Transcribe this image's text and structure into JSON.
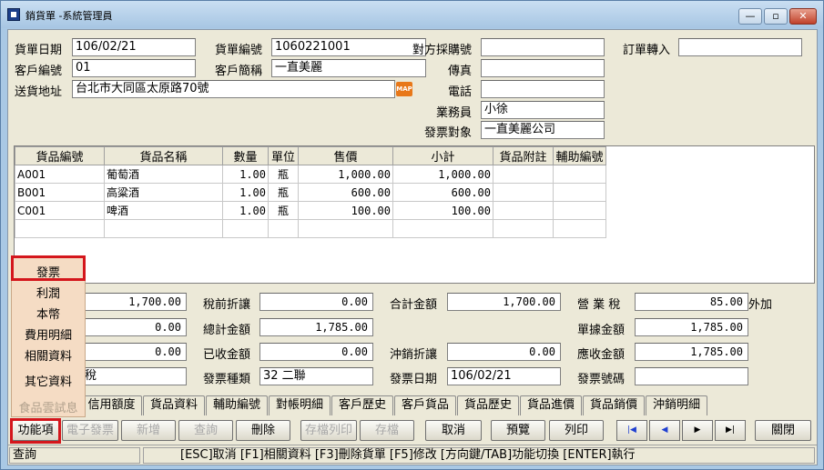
{
  "window": {
    "title": "銷貨單 -系統管理員",
    "min": "—",
    "max": "▫",
    "close": "✕"
  },
  "header": {
    "order_date_label": "貨單日期",
    "order_date": "106/02/21",
    "order_no_label": "貨單編號",
    "order_no": "1060221001",
    "po_label": "對方採購號",
    "po": "",
    "convert_label": "訂單轉入",
    "convert": "",
    "cust_no_label": "客戶編號",
    "cust_no": "01",
    "cust_name_label": "客戶簡稱",
    "cust_name": "一直美麗",
    "fax_label": "傳真",
    "fax": "",
    "address_label": "送貨地址",
    "address": "台北市大同區太原路70號",
    "map_label": "MAP",
    "phone_label": "電話",
    "phone": "",
    "sales_label": "業務員",
    "sales": "小徐",
    "invoice_to_label": "發票對象",
    "invoice_to": "一直美麗公司"
  },
  "grid": {
    "columns": [
      "貨品編號",
      "貨品名稱",
      "數量",
      "單位",
      "售價",
      "小計",
      "貨品附註",
      "輔助編號"
    ],
    "rows": [
      [
        "A001",
        "葡萄酒",
        "1.00",
        "瓶",
        "1,000.00",
        "1,000.00",
        "",
        ""
      ],
      [
        "B001",
        "高粱酒",
        "1.00",
        "瓶",
        "600.00",
        "600.00",
        "",
        ""
      ],
      [
        "C001",
        "啤酒",
        "1.00",
        "瓶",
        "100.00",
        "100.00",
        "",
        ""
      ]
    ]
  },
  "totals": {
    "left1": "1,700.00",
    "left2": "0.00",
    "left3": "0.00",
    "left4_tail": "稅",
    "pre_discount_label": "稅前折讓",
    "pre_discount": "0.00",
    "total_amount_label": "總計金額",
    "total_amount": "1,785.00",
    "received_label": "已收金額",
    "received": "0.00",
    "invoice_type_label": "發票種類",
    "invoice_type": "32 二聯",
    "sum_label": "合計金額",
    "sum": "1,700.00",
    "offset_label": "沖銷折讓",
    "offset": "0.00",
    "invoice_date_label": "發票日期",
    "invoice_date": "106/02/21",
    "tax_label": "營 業 稅",
    "tax": "85.00",
    "tax_suffix": "外加",
    "doc_amount_label": "單據金額",
    "doc_amount": "1,785.00",
    "receivable_label": "應收金額",
    "receivable": "1,785.00",
    "invoice_no_label": "發票號碼",
    "invoice_no": ""
  },
  "menu": {
    "items": [
      "發票",
      "利潤",
      "本幣",
      "費用明細",
      "相關資料",
      "其它資料"
    ],
    "faded": "食品雲試息"
  },
  "tabs": [
    "信用額度",
    "貨品資料",
    "輔助編號",
    "對帳明細",
    "客戶歷史",
    "客戶貨品",
    "貨品歷史",
    "貨品進價",
    "貨品銷價",
    "沖銷明細"
  ],
  "buttons": {
    "func": "功能項",
    "einvoice": "電子發票",
    "add": "新增",
    "query": "查詢",
    "delete": "刪除",
    "save_print": "存檔列印",
    "save": "存檔",
    "cancel": "取消",
    "preview": "預覽",
    "print": "列印",
    "first": "|◀",
    "prev": "◀",
    "next": "▶",
    "last": "▶|",
    "close": "關閉"
  },
  "status": {
    "mode": "查詢",
    "hint": "[ESC]取消 [F1]相關資料 [F3]刪除貨單 [F5]修改 [方向鍵/TAB]功能切換 [ENTER]執行"
  },
  "colors": {
    "highlight": "#d4161c",
    "menu_bg": "#f5dcc4",
    "client_bg": "#ece9d8"
  }
}
